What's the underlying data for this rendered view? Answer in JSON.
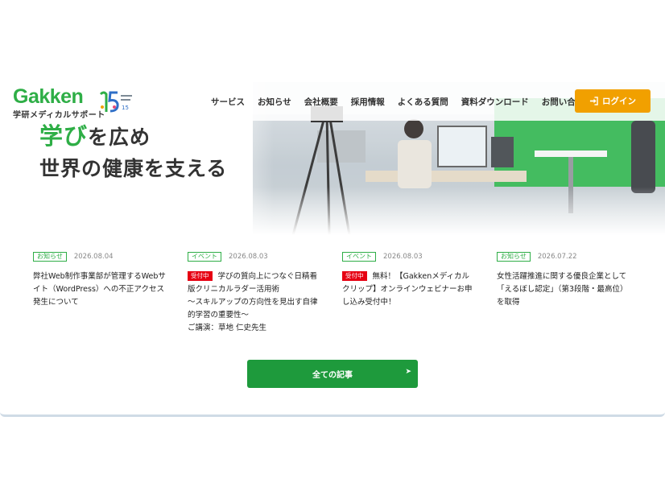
{
  "header": {
    "logo": "Gakken",
    "logo_sub": "学研メディカルサポート",
    "anniversary": "15",
    "nav": [
      "サービス",
      "お知らせ",
      "会社概要",
      "採用情報",
      "よくある質問",
      "資料ダウンロード",
      "お問い合わせ"
    ],
    "login_label": "ログイン"
  },
  "hero": {
    "catch_highlight": "学び",
    "catch_rest": "を広め",
    "catch_line2": "世界の健康を支える"
  },
  "news": [
    {
      "tag": "お知らせ",
      "date": "2026.08.04",
      "badge": "",
      "lines": [
        "弊社Web制作事業部が管理するWebサ",
        "イト（WordPress）への不正アクセス",
        "発生について"
      ]
    },
    {
      "tag": "イベント",
      "date": "2026.08.03",
      "badge": "受付中",
      "lines": [
        "学びの質向上につなぐ日精看",
        "版クリニカルラダー活用術",
        "〜スキルアップの方向性を見出す自律",
        "的学習の重要性〜",
        "ご講演：草地 仁史先生"
      ]
    },
    {
      "tag": "イベント",
      "date": "2026.08.03",
      "badge": "受付中",
      "lines": [
        "無料！【Gakkenメディカル",
        "クリップ】オンラインウェビナーお申",
        "し込み受付中！"
      ]
    },
    {
      "tag": "お知らせ",
      "date": "2026.07.22",
      "badge": "",
      "lines": [
        "女性活躍推進に関する優良企業として",
        "「えるぼし認定」（第3段階・最高位）",
        "を取得"
      ]
    }
  ],
  "all_articles_label": "全ての記事",
  "colors": {
    "brand_green": "#2eae46",
    "button_green": "#1e9a3c",
    "login_orange": "#f1a000",
    "badge_red": "#e60012"
  }
}
